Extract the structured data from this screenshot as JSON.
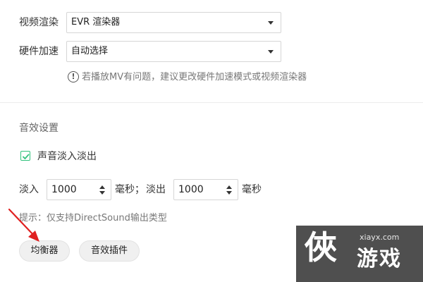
{
  "video": {
    "renderer_label": "视频渲染",
    "renderer_value": "EVR 渲染器",
    "hw_label": "硬件加速",
    "hw_value": "自动选择",
    "hint_icon": "!",
    "hint_text": "若播放MV有问题，建议更改硬件加速模式或视频渲染器"
  },
  "audio": {
    "section_title": "音效设置",
    "fade_checkbox_label": "声音淡入淡出",
    "fade_checked": true,
    "fade_in_label": "淡入",
    "fade_in_value": "1000",
    "fade_in_unit": "毫秒；",
    "fade_out_label": "淡出",
    "fade_out_value": "1000",
    "fade_out_unit": "毫秒",
    "tip_text": "提示：仅支持DirectSound输出类型",
    "equalizer_button": "均衡器",
    "plugin_button": "音效插件"
  },
  "watermark": {
    "site": "xiayx.com",
    "logo_glyph": "俠",
    "text": "游戏"
  },
  "colors": {
    "accent": "#31c27c",
    "arrow": "#e02020"
  },
  "icons": [
    "dropdown-caret-icon",
    "info-icon",
    "checkmark-icon",
    "spinner-arrow-icon",
    "red-arrow-icon"
  ]
}
